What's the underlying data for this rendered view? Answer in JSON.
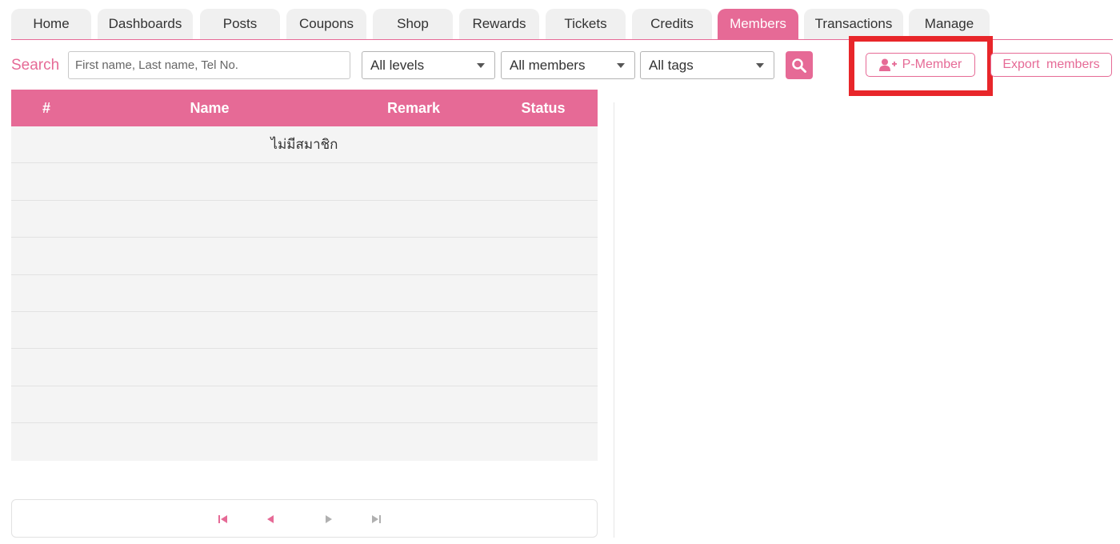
{
  "tabs": [
    {
      "label": "Home",
      "active": false
    },
    {
      "label": "Dashboards",
      "active": false
    },
    {
      "label": "Posts",
      "active": false
    },
    {
      "label": "Coupons",
      "active": false
    },
    {
      "label": "Shop",
      "active": false
    },
    {
      "label": "Rewards",
      "active": false
    },
    {
      "label": "Tickets",
      "active": false
    },
    {
      "label": "Credits",
      "active": false
    },
    {
      "label": "Members",
      "active": true
    },
    {
      "label": "Transactions",
      "active": false
    },
    {
      "label": "Manage",
      "active": false
    }
  ],
  "search": {
    "label": "Search",
    "placeholder": "First name, Last name, Tel No.",
    "value": ""
  },
  "filters": {
    "levels": "All levels",
    "members": "All members",
    "tags": "All tags"
  },
  "actions": {
    "p_member": "P-Member",
    "export_members": "Export members"
  },
  "table": {
    "columns": [
      "#",
      "Name",
      "Remark",
      "Status"
    ],
    "empty_message": "ไม่มีสมาชิก"
  },
  "pagination_icons": [
    "first-page-icon",
    "previous-page-icon",
    "next-page-icon",
    "last-page-icon"
  ],
  "colors": {
    "accent": "#e66a96",
    "highlight": "#e8262a",
    "tab_bg": "#f0f0f0",
    "row_bg": "#f4f4f4"
  }
}
